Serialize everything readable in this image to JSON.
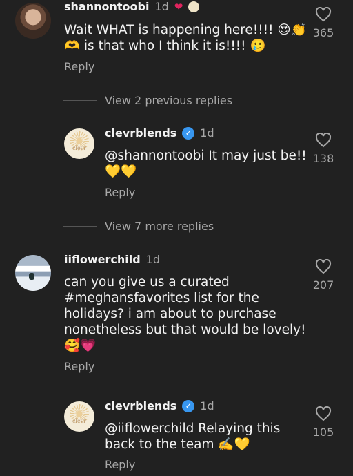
{
  "comments": [
    {
      "username": "shannontoobi",
      "time": "1d",
      "text_line1": "Wait WHAT is happening here!!!! 😍👏",
      "text_line2": "🫶 is that who I think it is!!!! 🥲",
      "reply_label": "Reply",
      "likes": "365"
    },
    {
      "username": "clevrblends",
      "time": "1d",
      "text_line1": "@shannontoobi It may just be!!",
      "text_line2": "💛💛",
      "reply_label": "Reply",
      "likes": "138",
      "avatar_text": "clevr"
    },
    {
      "username": "iiflowerchild",
      "time": "1d",
      "text_lines": [
        "can you give us a curated",
        "#meghansfavorites list for the",
        "holidays? i am about to purchase",
        "nonetheless but that would be lovely!",
        "🥰💗"
      ],
      "reply_label": "Reply",
      "likes": "207"
    },
    {
      "username": "clevrblends",
      "time": "1d",
      "text_line1": "@iiflowerchild Relaying this",
      "text_line2": "back to the team ✍️💛",
      "reply_label": "Reply",
      "likes": "105",
      "avatar_text": "clevr"
    }
  ],
  "view_previous": "View 2 previous replies",
  "view_more": "View 7 more replies",
  "colors": {
    "background": "#212121",
    "text": "#f2f2f2",
    "muted": "#a8a8a8",
    "verified": "#3897f0"
  }
}
